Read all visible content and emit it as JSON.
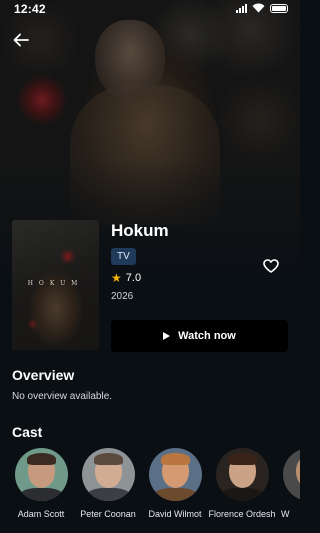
{
  "status_bar": {
    "time": "12:42"
  },
  "movie": {
    "title": "Hokum",
    "poster_title": "HOKUM",
    "type_badge": "TV",
    "rating": "7.0",
    "year": "2026",
    "watch_label": "Watch now"
  },
  "overview": {
    "heading": "Overview",
    "text": "No overview available."
  },
  "cast": {
    "heading": "Cast",
    "members": [
      {
        "name": "Adam Scott"
      },
      {
        "name": "Peter Coonan"
      },
      {
        "name": "David Wilmot"
      },
      {
        "name": "Florence Ordesh"
      },
      {
        "name": "W"
      }
    ]
  },
  "colors": {
    "background": "#0a0f14",
    "badge": "#1f3a5a",
    "star": "#f5b301",
    "button": "#000000"
  },
  "icons": [
    "back-arrow-icon",
    "heart-icon",
    "play-icon",
    "star-icon",
    "signal-icon",
    "wifi-icon",
    "battery-icon"
  ]
}
